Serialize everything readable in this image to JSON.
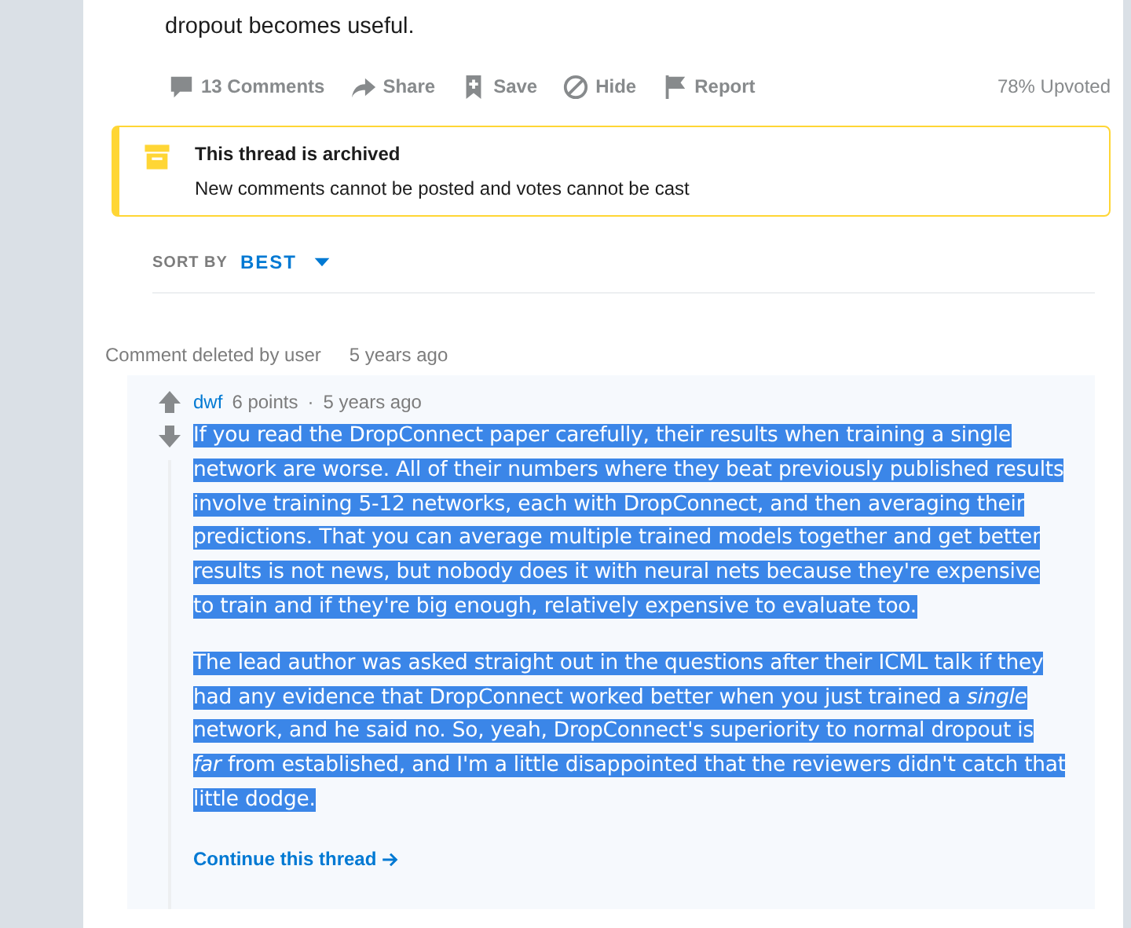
{
  "post": {
    "body_tail": "dropout becomes useful.",
    "actions": [
      {
        "kind": "comments",
        "label": "13 Comments"
      },
      {
        "kind": "share",
        "label": "Share"
      },
      {
        "kind": "save",
        "label": "Save"
      },
      {
        "kind": "hide",
        "label": "Hide"
      },
      {
        "kind": "report",
        "label": "Report"
      }
    ],
    "upvoted": "78% Upvoted"
  },
  "archived_notice": {
    "title": "This thread is archived",
    "text": "New comments cannot be posted and votes cannot be cast"
  },
  "sort": {
    "label": "SORT BY",
    "value": "BEST"
  },
  "deleted_comment": {
    "text": "Comment deleted by user",
    "time": "5 years ago"
  },
  "reply": {
    "author": "dwf",
    "points": "6 points",
    "separator": "·",
    "time": "5 years ago",
    "paragraphs": [
      {
        "text": "If you read the DropConnect paper carefully, their results when training a single network are worse. All of their numbers where they beat previously published results involve training 5-12 networks, each with DropConnect, and then averaging their predictions. That you can average multiple trained models together and get better results is not news, but nobody does it with neural nets because they're expensive to train and if they're big enough, relatively expensive to evaluate too.",
        "selected": true
      },
      {
        "text": "The lead author was asked straight out in the questions after their ICML talk if they had any evidence that DropConnect worked better when you just trained a *single* network, and he said no. So, yeah, DropConnect's superiority to normal dropout is *far* from established, and I'm a little disappointed that the reviewers didn't catch that little dodge.",
        "selected": true
      }
    ],
    "continue_link": "Continue this thread"
  }
}
